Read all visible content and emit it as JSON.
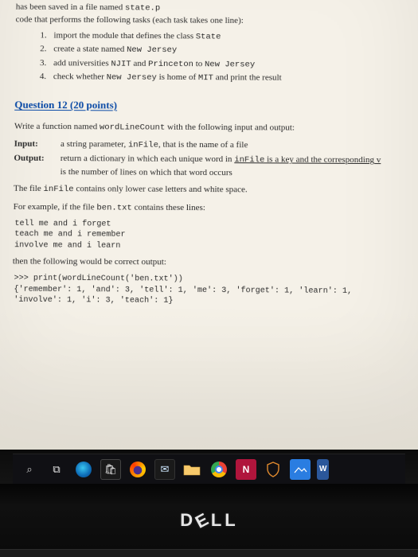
{
  "intro_prefix": "code that performs the following tasks (each task takes one line):",
  "intro_tail": " has been saved in a file named ",
  "intro_filename": "state.p",
  "tasks": [
    {
      "pre": "import the module that defines the class ",
      "code": "State",
      "post": ""
    },
    {
      "pre": "create a state named ",
      "code": "New Jersey",
      "post": ""
    },
    {
      "pre": "add universities ",
      "code": "NJIT",
      "mid": " and ",
      "code2": "Princeton",
      "mid2": " to ",
      "code3": "New Jersey",
      "post": ""
    },
    {
      "pre": "check whether ",
      "code": "New Jersey",
      "mid": " is home of ",
      "code2": "MIT",
      "post": " and print the result"
    }
  ],
  "q_heading": "Question 12 (20 points)",
  "q_intro_a": "Write a function named ",
  "q_intro_fn": "wordLineCount",
  "q_intro_b": " with the following input and output:",
  "input_label": "Input:",
  "input_text_a": "a string parameter, ",
  "input_code": "inFile",
  "input_text_b": ", that is the name of a file",
  "output_label": "Output:",
  "output_text_a": "return a dictionary in which each unique word in ",
  "output_code": "inFile",
  "output_text_b": " is a key and the corresponding v",
  "output_text_c": "is the number of lines on which that word occurs",
  "note_a": "The file ",
  "note_code": "inFile",
  "note_b": " contains only lower case letters and white space.",
  "example_intro_a": "For example, if the file ",
  "example_file": "ben.txt",
  "example_intro_b": " contains these lines:",
  "example_lines": "tell me and i forget\nteach me and i remember\ninvolve me and i learn",
  "then_text": "then the following would be correct output:",
  "repl": ">>> print(wordLineCount('ben.txt'))\n{'remember': 1, 'and': 3, 'tell': 1, 'me': 3, 'forget': 1, 'learn': 1,\n'involve': 1, 'i': 3, 'teach': 1}",
  "taskbar": {
    "search": "⌕",
    "tasks": "⧉",
    "store": "🛍",
    "mail": "✉",
    "word": "W"
  },
  "logo": {
    "d": "D",
    "e": "E",
    "l1": "L",
    "l2": "L"
  }
}
